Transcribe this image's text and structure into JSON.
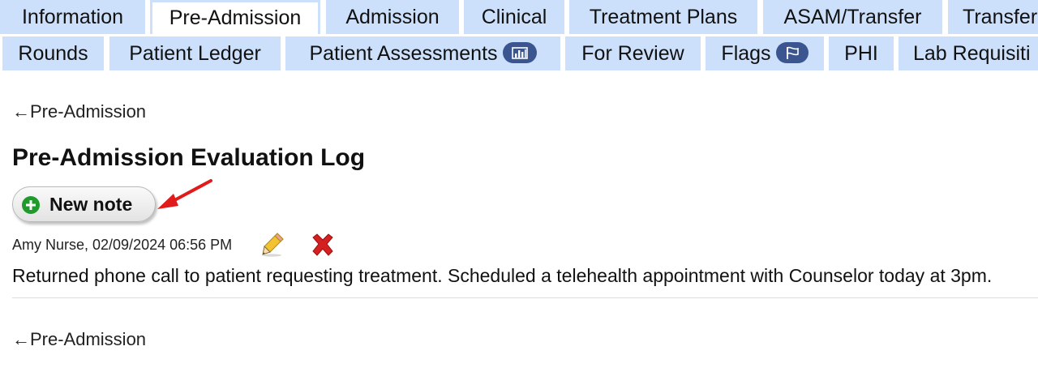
{
  "tabs_row1": [
    {
      "label": "Information"
    },
    {
      "label": "Pre-Admission",
      "active": true
    },
    {
      "label": "Admission"
    },
    {
      "label": "Clinical"
    },
    {
      "label": "Treatment Plans"
    },
    {
      "label": "ASAM/Transfer"
    },
    {
      "label": "Transfer"
    }
  ],
  "tabs_row2": [
    {
      "label": "Rounds"
    },
    {
      "label": "Patient Ledger"
    },
    {
      "label": "Patient Assessments",
      "icon": "bar-chart-icon"
    },
    {
      "label": "For Review"
    },
    {
      "label": "Flags",
      "icon": "flag-icon"
    },
    {
      "label": "PHI"
    },
    {
      "label": "Lab Requisiti"
    }
  ],
  "back_link": "←Pre-Admission",
  "page_title": "Pre-Admission Evaluation Log",
  "new_note_label": "New note",
  "notes": [
    {
      "author_time": "Amy Nurse, 02/09/2024 06:56 PM",
      "body": "Returned phone call to patient requesting treatment. Scheduled a telehealth appointment with Counselor today at 3pm."
    }
  ],
  "colors": {
    "tab_bg": "#cde0fb",
    "badge_bg": "#3a5590",
    "plus_green": "#1f9a2b",
    "delete_red": "#d42020",
    "arrow_red": "#e01b1b"
  }
}
